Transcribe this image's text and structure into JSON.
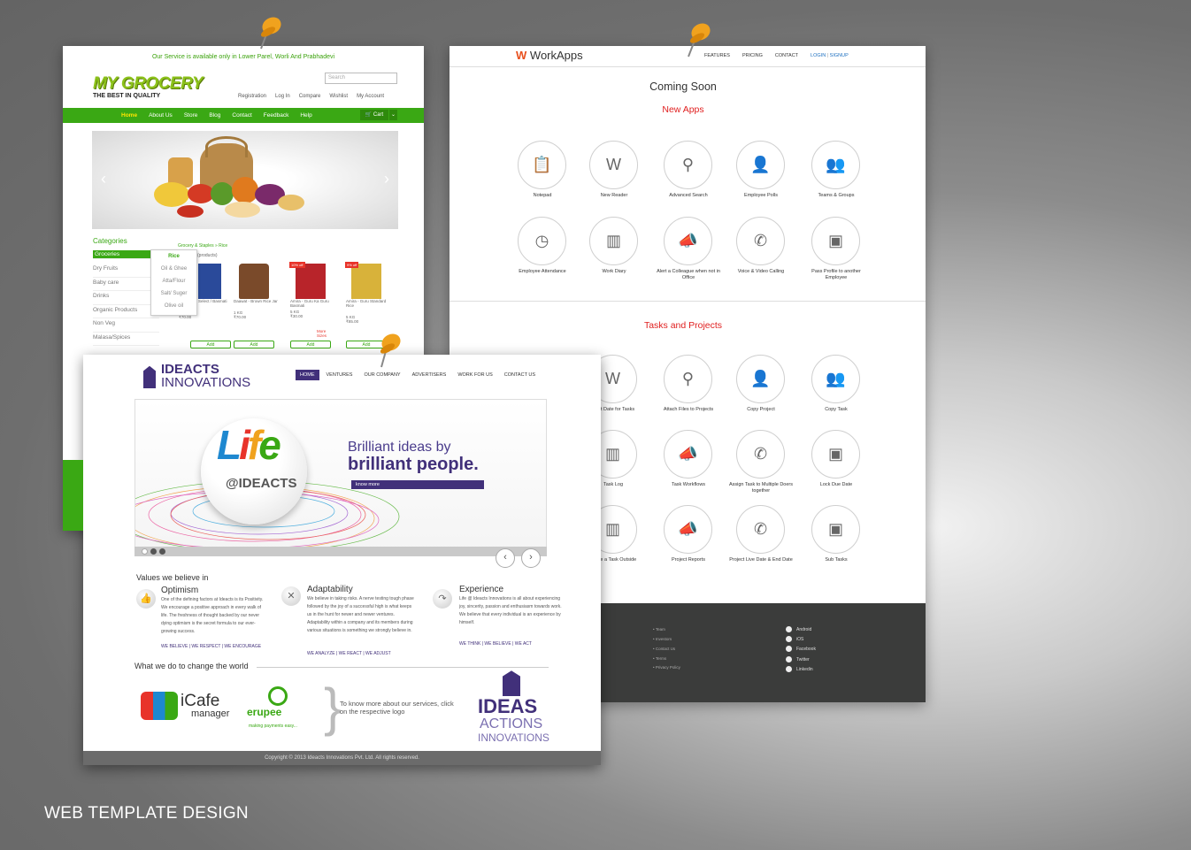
{
  "caption": "WEB TEMPLATE DESIGN",
  "grocery": {
    "notice": "Our Service is available only in Lower Parel, Worli And Prabhadevi",
    "logo": "MY GROCERY",
    "tagline": "THE BEST IN QUALITY",
    "search_placeholder": "Search",
    "top_links": [
      "Registration",
      "Log In",
      "Compare",
      "Wishlist",
      "My Account"
    ],
    "nav": [
      "Home",
      "About Us",
      "Store",
      "Blog",
      "Contact",
      "Feedback",
      "Help"
    ],
    "cart_label": "Cart",
    "categories_title": "Categories",
    "categories": [
      "Groceries",
      "Dry Fruits",
      "Baby care",
      "Drinks",
      "Organic Products",
      "Non Veg",
      "Malasa/Spices"
    ],
    "dropdown": [
      "Rice",
      "Oil & Ghee",
      "Atta/Flour",
      "Salt/ Suger",
      "Olive oil"
    ],
    "breadcrumb": "Grocery & Staples » Rice",
    "product_count": "(products)",
    "products": [
      {
        "name": "Select / Basmati",
        "qty": "",
        "price": "",
        "add": "Add",
        "badge": ""
      },
      {
        "name": "Daawat - Brown Rice Jar",
        "qty": "1 KG",
        "price": "₹70.00",
        "add": "Add",
        "badge": ""
      },
      {
        "name": "Amira - Guru Ka Guru Basmati",
        "qty": "5 KG",
        "price": "₹30.00",
        "more": "More Sizes",
        "add": "Add",
        "badge": "10% off"
      },
      {
        "name": "Amira - Guru Standard Rice",
        "qty": "5 KG",
        "price": "₹85.00",
        "add": "Add",
        "badge": "9% off"
      }
    ],
    "first_product": {
      "qty": "5 KG",
      "price": "₹70.00"
    }
  },
  "workapps": {
    "brand": "WorkApps",
    "menu": [
      "FEATURES",
      "PRICING",
      "CONTACT"
    ],
    "login": "LOGIN",
    "signup": "SIGNUP",
    "coming_soon": "Coming Soon",
    "new_apps_title": "New Apps",
    "new_apps": [
      {
        "label": "Notepad",
        "icon": "📋"
      },
      {
        "label": "New Reader",
        "icon": "W"
      },
      {
        "label": "Advanced Search",
        "icon": "⚲"
      },
      {
        "label": "Employee Polls",
        "icon": "👤"
      },
      {
        "label": "Teams & Groups",
        "icon": "👥"
      },
      {
        "label": "Employee Attendance",
        "icon": "◷"
      },
      {
        "label": "Work Diary",
        "icon": "▥"
      },
      {
        "label": "Alert a Colleague when not in Office",
        "icon": "📣"
      },
      {
        "label": "Voice & Video Calling",
        "icon": "✆"
      },
      {
        "label": "Pass Profile to another Employee",
        "icon": "▣"
      }
    ],
    "tasks_title": "Tasks and Projects",
    "tasks": [
      {
        "label": "Start Date for Tasks",
        "icon": "W"
      },
      {
        "label": "Attach Files to Projects",
        "icon": "⚲"
      },
      {
        "label": "Copy Project",
        "icon": "👤"
      },
      {
        "label": "Copy Task",
        "icon": "👥"
      },
      {
        "label": "Task Log",
        "icon": "▥"
      },
      {
        "label": "Task Workflows",
        "icon": "📣"
      },
      {
        "label": "Assign Task to Multiple Doers together",
        "icon": "✆"
      },
      {
        "label": "Lock Due Date",
        "icon": "▣"
      },
      {
        "label": "Share a Task Outside",
        "icon": "▥"
      },
      {
        "label": "Project Reports",
        "icon": "📣"
      },
      {
        "label": "Project Live Date & End Date",
        "icon": "✆"
      },
      {
        "label": "Sub Tasks",
        "icon": "▣"
      }
    ],
    "footer_links": [
      "Team",
      "Investors",
      "Contact Us",
      "Terms",
      "Privacy Policy"
    ],
    "social": [
      "Android",
      "iOS",
      "Facebook",
      "Twitter",
      "Linkedin"
    ]
  },
  "ideacts": {
    "logo_line1": "IDEACTS",
    "logo_line2": "INNOVATIONS",
    "nav": [
      "HOME",
      "VENTURES",
      "OUR COMPANY",
      "ADVERTISERS",
      "WORK FOR US",
      "CONTACT US"
    ],
    "slide_life": "Life",
    "slide_at": "@IDEACTS",
    "slide_line1": "Brilliant ideas by",
    "slide_line2": "brilliant people.",
    "know_more": "know more",
    "values_title": "Values we believe in",
    "values": [
      {
        "title": "Optimism",
        "body": "One of the defining factors at Ideacts is its Positivity. We encourage a positive approach in every walk of life. The freshness of thought backed by our never dying optimism is the secret formula to our ever-growing success.",
        "links": "WE BELIEVE | WE RESPECT | WE ENCOURAGE"
      },
      {
        "title": "Adaptability",
        "body": "We believe in taking risks. A nerve testing tough phase followed by the joy of a successful high is what keeps us in the hunt for newer and newer ventures. Adaptability within a company and its members during various situations is something we strongly believe in.",
        "links": "WE ANALYZE | WE REACT | WE ADJUST"
      },
      {
        "title": "Experience",
        "body": "Life @ Ideacts Innovations is all about experiencing joy, sincerity, passion and enthusiasm towards work. We believe that every individual is an experience by himself.",
        "links": "WE THINK | WE BELIEVE | WE ACT"
      }
    ],
    "what_title": "What we do to change the world",
    "icafe": "iCafe",
    "icafe_sub": "manager",
    "erupee": "erupee",
    "erupee_sub": "making payments easy...",
    "know_text": "To know more about our services, click on the respective logo",
    "ideas": "IDEAS",
    "actions": "ACTIONS",
    "innovations": "INNOVATIONS",
    "copyright": "Copyright © 2013 Ideacts Innovations Pvt. Ltd. All rights reserved."
  }
}
